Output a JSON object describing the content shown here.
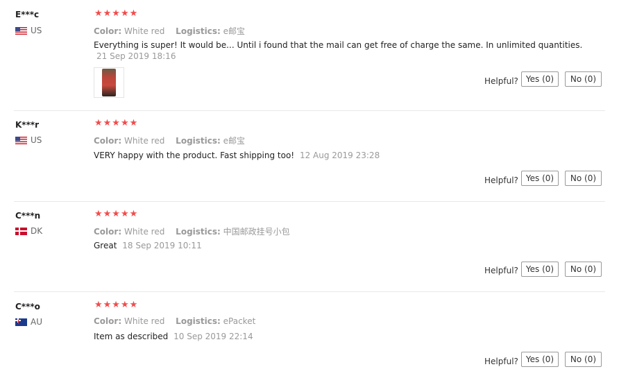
{
  "labels": {
    "color": "Color:",
    "logistics": "Logistics:",
    "helpful": "Helpful?"
  },
  "reviews": [
    {
      "user": "E***c",
      "country": "US",
      "flag": "us-flag",
      "stars": "★★★★★",
      "color_value": "White red",
      "logistics_value": "e邮宝",
      "text": "Everything is super! It would be... Until i found that the mail can get free of charge the same. In unlimited quantities.",
      "date": "21 Sep 2019 18:16",
      "has_photo": true,
      "yes": "Yes (0)",
      "no": "No (0)"
    },
    {
      "user": "K***r",
      "country": "US",
      "flag": "us-flag",
      "stars": "★★★★★",
      "color_value": "White red",
      "logistics_value": "e邮宝",
      "text": "VERY happy with the product. Fast shipping too!",
      "date": "12 Aug 2019 23:28",
      "yes": "Yes (0)",
      "no": "No (0)"
    },
    {
      "user": "C***n",
      "country": "DK",
      "flag": "dk-flag",
      "stars": "★★★★★",
      "color_value": "White red",
      "logistics_value": "中国邮政挂号小包",
      "text": "Great",
      "date": "18 Sep 2019 10:11",
      "yes": "Yes (0)",
      "no": "No (0)"
    },
    {
      "user": "C***o",
      "country": "AU",
      "flag": "au-flag",
      "stars": "★★★★★",
      "color_value": "White red",
      "logistics_value": "ePacket",
      "text": "Item as described",
      "date": "10 Sep 2019 22:14",
      "yes": "Yes (0)",
      "no": "No (0)"
    }
  ]
}
